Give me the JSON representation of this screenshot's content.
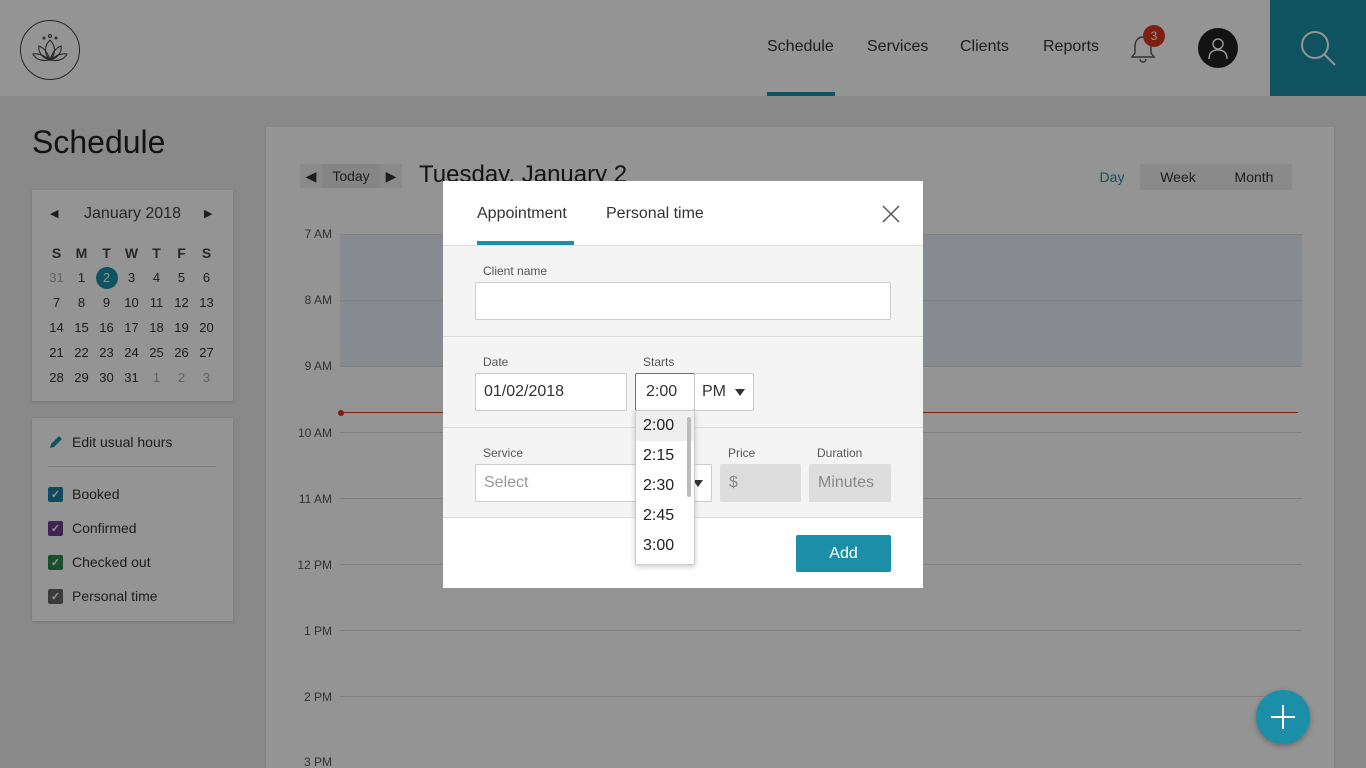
{
  "header": {
    "nav": [
      "Schedule",
      "Services",
      "Clients",
      "Reports"
    ],
    "notification_count": "3",
    "colors": {
      "accent": "#1b8fa8",
      "badge": "#d9381e"
    },
    "icons": [
      "lotus-logo-icon",
      "bell-icon",
      "user-icon",
      "search-icon"
    ]
  },
  "page": {
    "title": "Schedule"
  },
  "mini_calendar": {
    "title": "January 2018",
    "weekdays": [
      "S",
      "M",
      "T",
      "W",
      "T",
      "F",
      "S"
    ],
    "weeks": [
      [
        "31",
        "1",
        "2",
        "3",
        "4",
        "5",
        "6"
      ],
      [
        "7",
        "8",
        "9",
        "10",
        "11",
        "12",
        "13"
      ],
      [
        "14",
        "15",
        "16",
        "17",
        "18",
        "19",
        "20"
      ],
      [
        "21",
        "22",
        "23",
        "24",
        "25",
        "26",
        "27"
      ],
      [
        "28",
        "29",
        "30",
        "31",
        "1",
        "2",
        "3"
      ]
    ],
    "selected": "2"
  },
  "filters": {
    "edit_hours": "Edit usual hours",
    "items": [
      {
        "label": "Booked",
        "color": "#1b7fa0"
      },
      {
        "label": "Confirmed",
        "color": "#6b3d8f"
      },
      {
        "label": "Checked out",
        "color": "#2b8a4a"
      },
      {
        "label": "Personal time",
        "color": "#666666"
      }
    ]
  },
  "calendar": {
    "today_label": "Today",
    "date_title": "Tuesday, January 2",
    "views": [
      "Day",
      "Week",
      "Month"
    ],
    "active_view": "Day",
    "hours": [
      "7 AM",
      "8 AM",
      "9 AM",
      "10 AM",
      "11 AM",
      "12 PM",
      "1 PM",
      "2 PM",
      "3 PM"
    ]
  },
  "modal": {
    "tabs": [
      "Appointment",
      "Personal time"
    ],
    "active_tab": "Appointment",
    "client_name_label": "Client name",
    "client_name_value": "",
    "date_label": "Date",
    "date_value": "01/02/2018",
    "starts_label": "Starts",
    "starts_value": "2:00",
    "ampm_value": "PM",
    "service_label": "Service",
    "service_placeholder": "Select",
    "price_label": "Price",
    "price_placeholder": "$",
    "duration_label": "Duration",
    "duration_placeholder": "Minutes",
    "add_label": "Add",
    "time_options": [
      "2:00",
      "2:15",
      "2:30",
      "2:45",
      "3:00"
    ],
    "selected_time": "2:00"
  }
}
